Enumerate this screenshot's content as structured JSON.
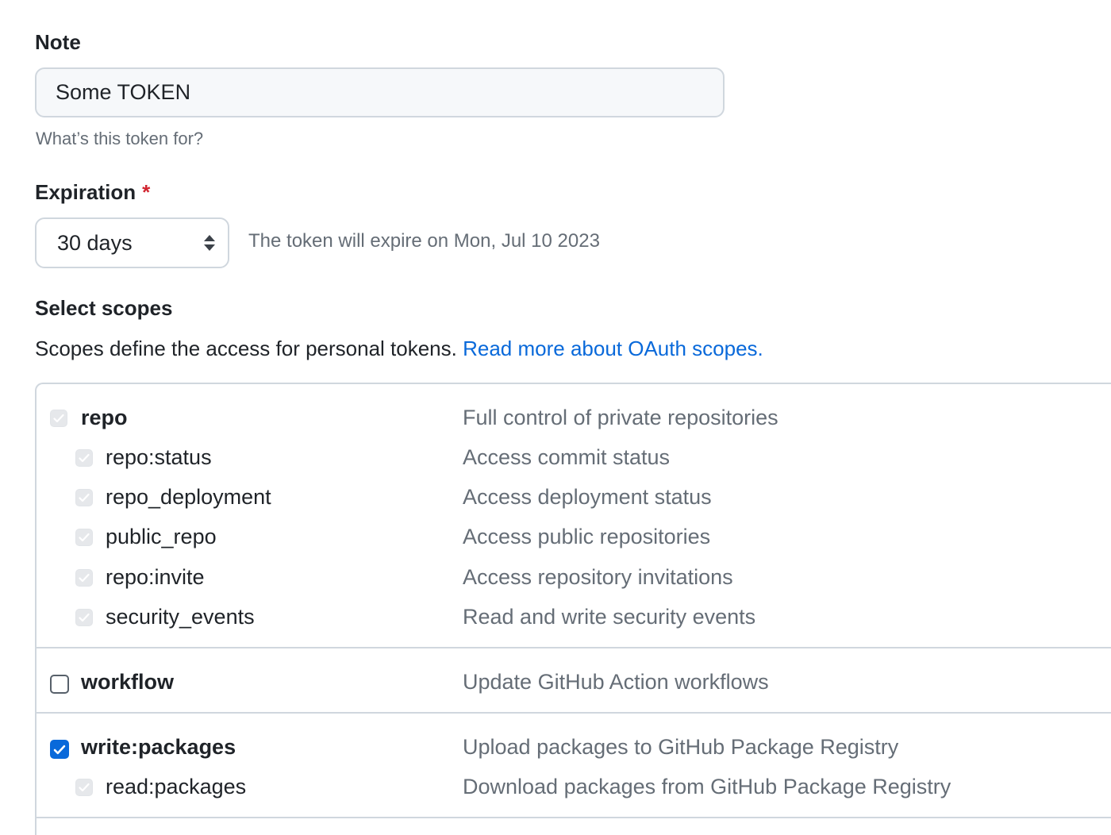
{
  "note": {
    "label": "Note",
    "value": "Some TOKEN",
    "hint": "What’s this token for?"
  },
  "expiration": {
    "label": "Expiration",
    "required_mark": "*",
    "selected": "30 days",
    "info": "The token will expire on Mon, Jul 10 2023"
  },
  "scopes": {
    "title": "Select scopes",
    "description": "Scopes define the access for personal tokens.",
    "link_text": "Read more about OAuth scopes.",
    "groups": [
      {
        "parent": {
          "name": "repo",
          "description": "Full control of private repositories",
          "state": "disabled-checked"
        },
        "children": [
          {
            "name": "repo:status",
            "description": "Access commit status",
            "state": "disabled-checked"
          },
          {
            "name": "repo_deployment",
            "description": "Access deployment status",
            "state": "disabled-checked"
          },
          {
            "name": "public_repo",
            "description": "Access public repositories",
            "state": "disabled-checked"
          },
          {
            "name": "repo:invite",
            "description": "Access repository invitations",
            "state": "disabled-checked"
          },
          {
            "name": "security_events",
            "description": "Read and write security events",
            "state": "disabled-checked"
          }
        ]
      },
      {
        "parent": {
          "name": "workflow",
          "description": "Update GitHub Action workflows",
          "state": "unchecked"
        },
        "children": []
      },
      {
        "parent": {
          "name": "write:packages",
          "description": "Upload packages to GitHub Package Registry",
          "state": "checked"
        },
        "children": [
          {
            "name": "read:packages",
            "description": "Download packages from GitHub Package Registry",
            "state": "disabled-checked"
          }
        ]
      }
    ]
  },
  "colors": {
    "link": "#0969da",
    "required": "#d1242f",
    "checkbox_checked": "#0969da",
    "muted_text": "#656d76",
    "border": "#d0d7de"
  }
}
